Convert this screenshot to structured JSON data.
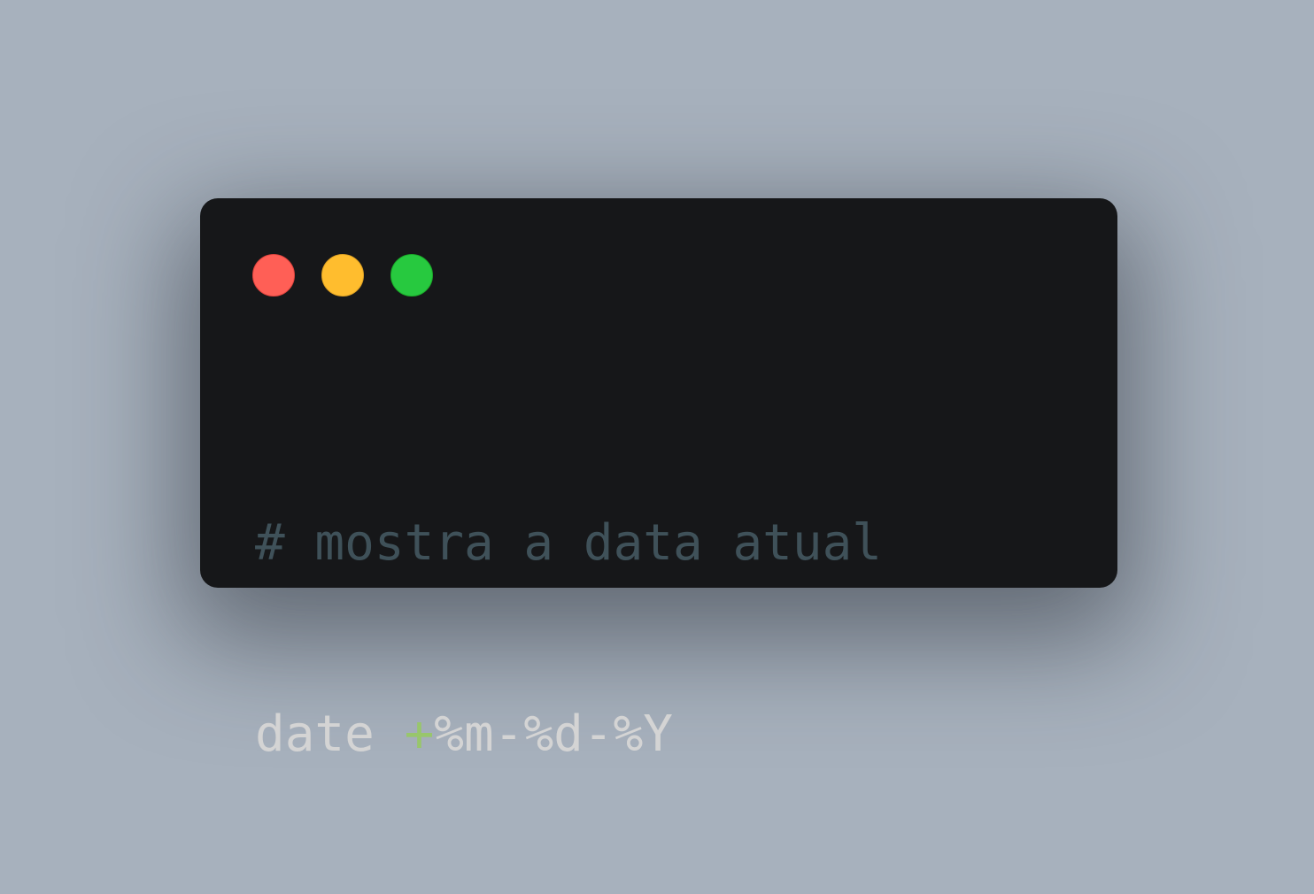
{
  "window": {
    "controls": [
      {
        "name": "close",
        "color": "#ff5f56"
      },
      {
        "name": "minimize",
        "color": "#ffbd2e"
      },
      {
        "name": "maximize",
        "color": "#27c93f"
      }
    ]
  },
  "code": {
    "comment": "# mostra a data atual",
    "command": "date",
    "space": " ",
    "operator": "+",
    "format": "%m-%d-%Y"
  },
  "colors": {
    "background": "#a7b1bd",
    "window": "#161719",
    "comment": "#3f5159",
    "text": "#d4d4d4",
    "operator": "#98c66c"
  }
}
